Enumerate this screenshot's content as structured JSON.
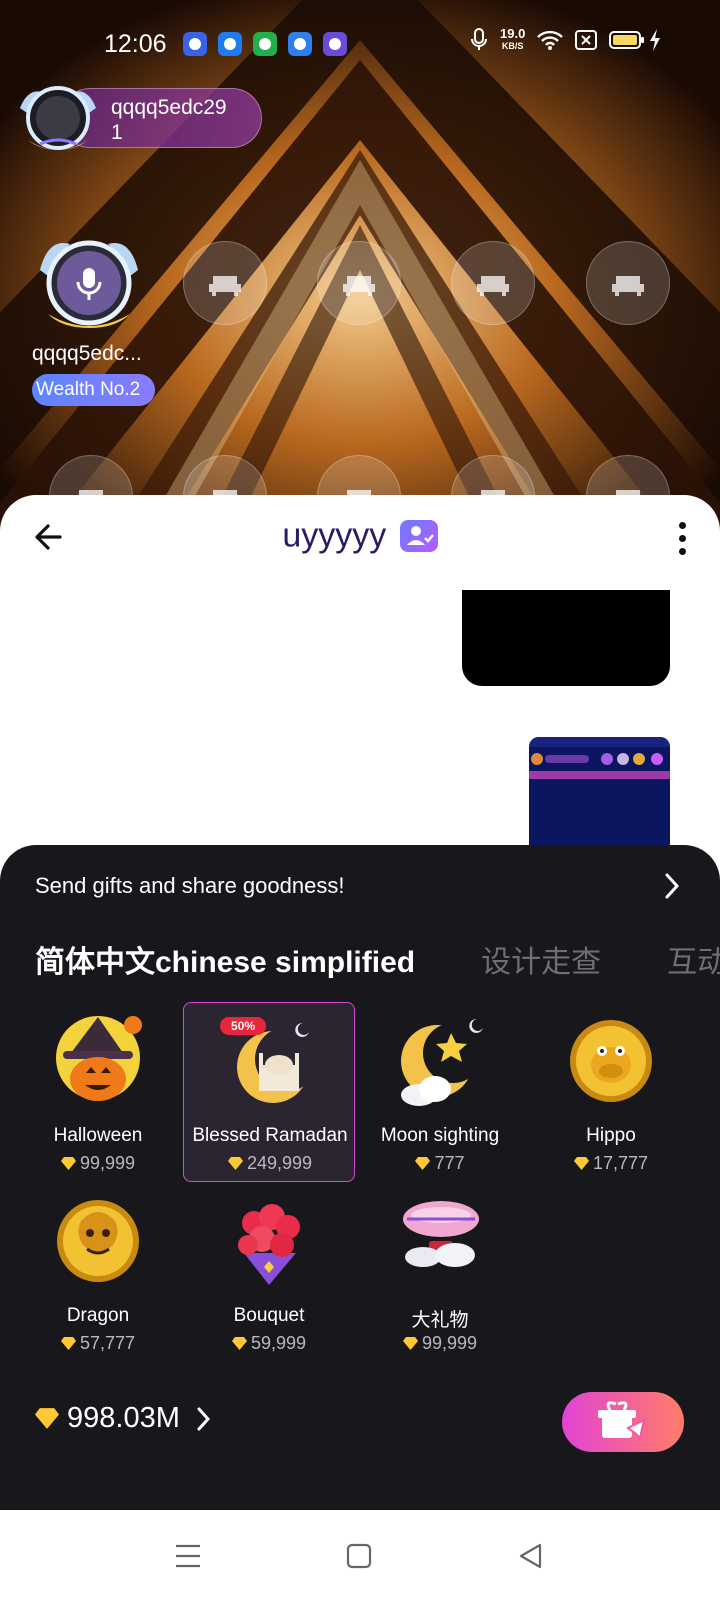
{
  "status_bar": {
    "time": "12:06",
    "net_speed": "19.0",
    "net_unit": "KB/S",
    "icons": [
      "baidu-app-icon",
      "video-app-icon",
      "shopping-app-icon",
      "search-app-icon",
      "browser-app-icon",
      "mic-icon",
      "wifi-icon",
      "sim-icon",
      "battery-icon",
      "charging-icon"
    ]
  },
  "room": {
    "host_name": "qqqq5edc29\n1",
    "seat_user_name": "qqqq5edc...",
    "seat_badge": "Wealth No.2"
  },
  "chat": {
    "title": "uyyyyy"
  },
  "gift_sheet": {
    "header": "Send gifts and share goodness!",
    "tabs": [
      "简体中文chinese simplified",
      "设计走查",
      "互动"
    ],
    "promo_label": "50%",
    "gifts": [
      {
        "name": "Halloween",
        "price": "99,999"
      },
      {
        "name": "Blessed Ramadan",
        "price": "249,999"
      },
      {
        "name": "Moon sighting",
        "price": "777"
      },
      {
        "name": "Hippo",
        "price": "17,777"
      },
      {
        "name": "Dragon",
        "price": "57,777"
      },
      {
        "name": "Bouquet",
        "price": "59,999"
      },
      {
        "name": "大礼物",
        "price": "99,999"
      }
    ],
    "balance": "998.03M"
  },
  "colors": {
    "accent": "#d24bd0",
    "sheet_bg": "#18171c",
    "chat_title": "#2a1a66"
  }
}
